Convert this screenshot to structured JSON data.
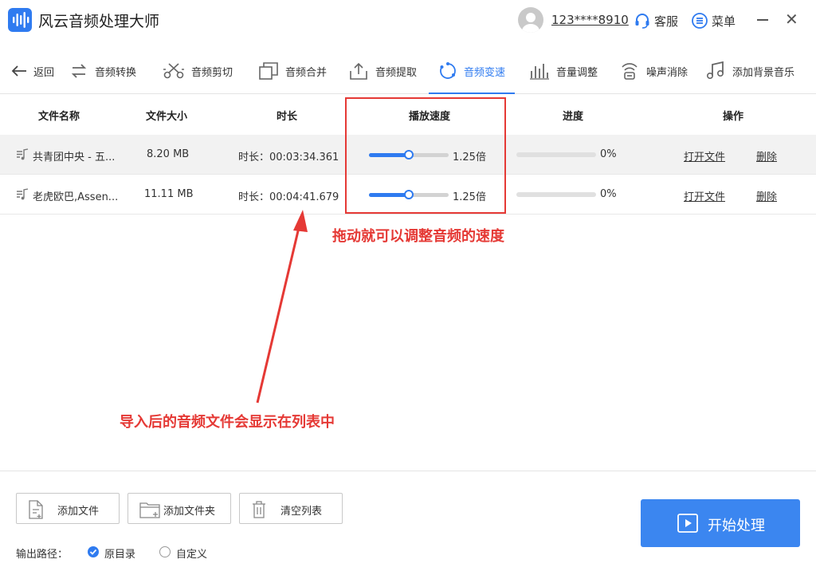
{
  "app": {
    "title": "风云音频处理大师",
    "username": "123****8910",
    "service_label": "客服",
    "menu_label": "菜单"
  },
  "toolbar": {
    "back_label": "返回",
    "items": [
      {
        "label": "音频转换",
        "icon": "convert-icon"
      },
      {
        "label": "音频剪切",
        "icon": "scissors-icon"
      },
      {
        "label": "音频合并",
        "icon": "merge-icon"
      },
      {
        "label": "音频提取",
        "icon": "extract-icon"
      },
      {
        "label": "音频变速",
        "icon": "speed-icon",
        "active": true
      },
      {
        "label": "音量调整",
        "icon": "volume-bars-icon"
      },
      {
        "label": "噪声消除",
        "icon": "noise-icon"
      },
      {
        "label": "添加背景音乐",
        "icon": "music-note-icon"
      }
    ]
  },
  "table": {
    "headers": {
      "name": "文件名称",
      "size": "文件大小",
      "duration": "时长",
      "speed": "播放速度",
      "progress": "进度",
      "actions": "操作"
    },
    "rows": [
      {
        "name": "共青团中央 - 五...",
        "size": "8.20 MB",
        "duration": "时长：00:03:34.361",
        "speed_value": 0.5,
        "speed_label": "1.25倍",
        "progress_value": 0,
        "progress_label": "0%",
        "open_label": "打开文件",
        "delete_label": "删除"
      },
      {
        "name": "老虎欧巴,Assen...",
        "size": "11.11 MB",
        "duration": "时长：00:04:41.679",
        "speed_value": 0.5,
        "speed_label": "1.25倍",
        "progress_value": 0,
        "progress_label": "0%",
        "open_label": "打开文件",
        "delete_label": "删除"
      }
    ]
  },
  "annotations": {
    "speed_tip": "拖动就可以调整音频的速度",
    "list_tip": "导入后的音频文件会显示在列表中"
  },
  "bottom": {
    "add_file": "添加文件",
    "add_folder": "添加文件夹",
    "clear_list": "清空列表",
    "start": "开始处理",
    "output_label": "输出路径：",
    "option_original": "原目录",
    "option_custom": "自定义"
  },
  "colors": {
    "accent": "#2f7bf0",
    "annotation": "#e53935"
  }
}
